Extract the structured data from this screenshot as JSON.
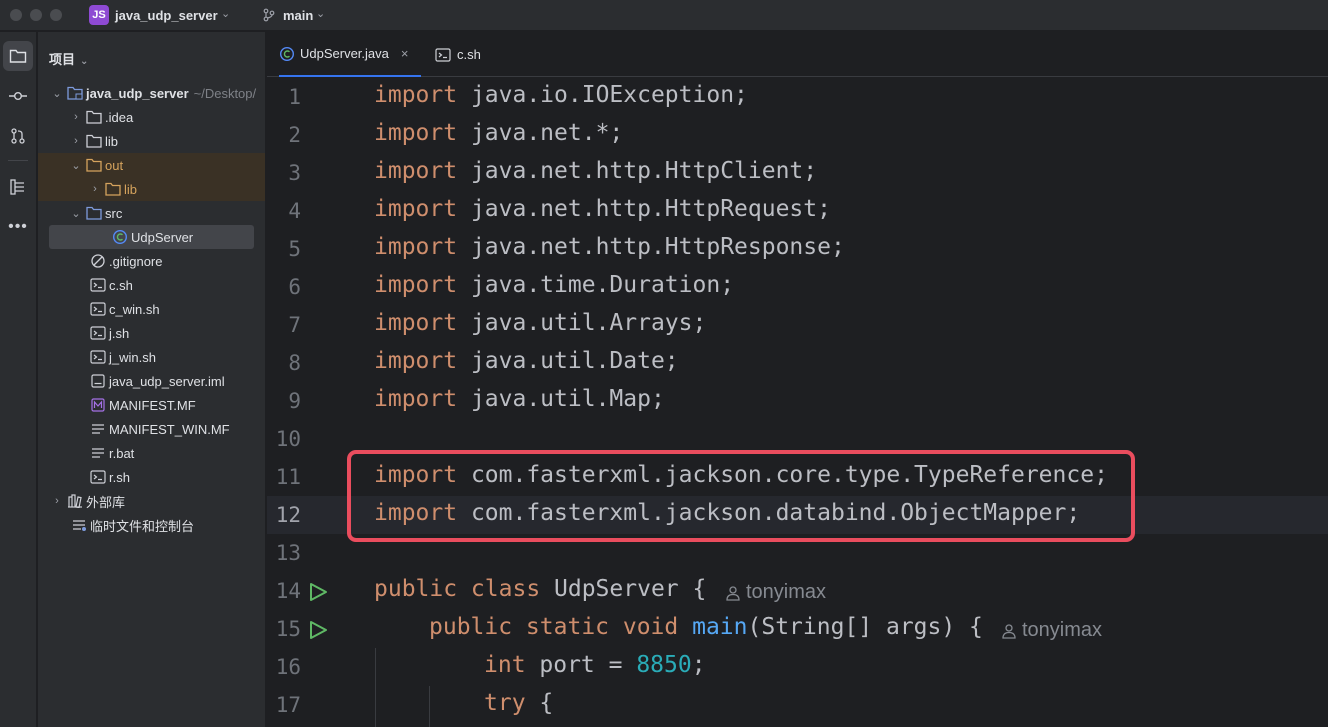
{
  "titlebar": {
    "badge": "JS",
    "project": "java_udp_server",
    "branch": "main"
  },
  "panel": {
    "title": "项目"
  },
  "tree": [
    {
      "label": "java_udp_server",
      "path": "~/Desktop/"
    },
    {
      "label": ".idea"
    },
    {
      "label": "lib"
    },
    {
      "label": "out"
    },
    {
      "label": "lib"
    },
    {
      "label": "src"
    },
    {
      "label": "UdpServer"
    },
    {
      "label": ".gitignore"
    },
    {
      "label": "c.sh"
    },
    {
      "label": "c_win.sh"
    },
    {
      "label": "j.sh"
    },
    {
      "label": "j_win.sh"
    },
    {
      "label": "java_udp_server.iml"
    },
    {
      "label": "MANIFEST.MF"
    },
    {
      "label": "MANIFEST_WIN.MF"
    },
    {
      "label": "r.bat"
    },
    {
      "label": "r.sh"
    },
    {
      "label": "外部库"
    },
    {
      "label": "临时文件和控制台"
    }
  ],
  "tabs": [
    {
      "label": "UdpServer.java"
    },
    {
      "label": "c.sh"
    }
  ],
  "code": {
    "line_numbers": [
      "1",
      "2",
      "3",
      "4",
      "5",
      "6",
      "7",
      "8",
      "9",
      "10",
      "11",
      "12",
      "13",
      "14",
      "15",
      "16",
      "17"
    ],
    "lines": [
      {
        "k": "import",
        "t": " java.io.IOException;"
      },
      {
        "k": "import",
        "t": " java.net.*;"
      },
      {
        "k": "import",
        "t": " java.net.http.HttpClient;"
      },
      {
        "k": "import",
        "t": " java.net.http.HttpRequest;"
      },
      {
        "k": "import",
        "t": " java.net.http.HttpResponse;"
      },
      {
        "k": "import",
        "t": " java.time.Duration;"
      },
      {
        "k": "import",
        "t": " java.util.Arrays;"
      },
      {
        "k": "import",
        "t": " java.util.Date;"
      },
      {
        "k": "import",
        "t": " java.util.Map;"
      },
      {
        "k": "",
        "t": ""
      },
      {
        "k": "import",
        "t": " com.fasterxml.jackson.core.type.TypeReference;"
      },
      {
        "k": "import",
        "t": " com.fasterxml.jackson.databind.ObjectMapper;"
      }
    ],
    "line14": {
      "kw": "public class",
      "name": " UdpServer {"
    },
    "line15": {
      "kw": "public static void",
      "fn": "main",
      "rest": "(String[] args) {"
    },
    "line16": {
      "kw": "int",
      "mid": " port = ",
      "num": "8850",
      "end": ";"
    },
    "line17": {
      "kw": "try",
      "rest": " {"
    },
    "author": "tonyimax"
  },
  "colors": {
    "keyword": "#cf8e6d",
    "function": "#56a8f5",
    "number": "#2aacb8",
    "highlight_box": "#ea4d5e",
    "accent": "#3574f0"
  }
}
